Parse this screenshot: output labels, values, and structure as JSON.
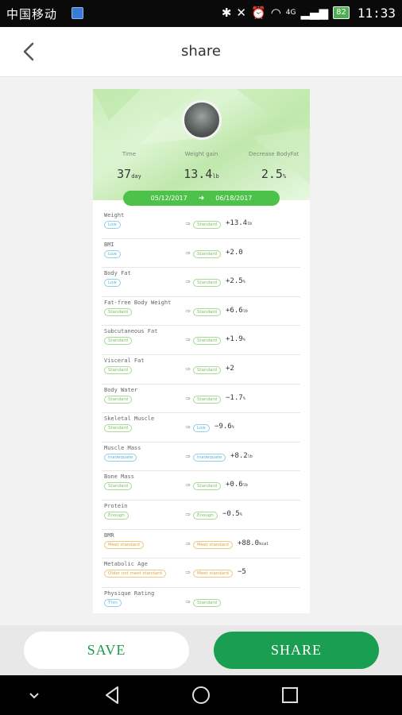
{
  "status_bar": {
    "carrier": "中国移动",
    "battery": "82",
    "network": "4G",
    "time": "11:33"
  },
  "header": {
    "title": "share",
    "back_icon": "chevron-left-icon"
  },
  "summary": {
    "labels": [
      "Time",
      "Weight gain",
      "Decrease BodyFat"
    ],
    "time_value": "37",
    "time_unit": "day",
    "weight_value": "13.4",
    "weight_unit": "lb",
    "fat_value": "2.5",
    "fat_unit": "%"
  },
  "range": {
    "start": "05/12/2017",
    "end": "06/18/2017"
  },
  "metrics": [
    {
      "name": "Weight",
      "from": "Low",
      "to": "Standard",
      "change": "+13.4",
      "unit": "lb"
    },
    {
      "name": "BMI",
      "from": "Low",
      "to": "Standard",
      "change": "+2.0",
      "unit": ""
    },
    {
      "name": "Body Fat",
      "from": "Low",
      "to": "Standard",
      "change": "+2.5",
      "unit": "%"
    },
    {
      "name": "Fat-free Body Weight",
      "from": "Standard",
      "to": "Standard",
      "change": "+6.6",
      "unit": "lb"
    },
    {
      "name": "Subcutaneous Fat",
      "from": "Standard",
      "to": "Standard",
      "change": "+1.9",
      "unit": "%"
    },
    {
      "name": "Visceral Fat",
      "from": "Standard",
      "to": "Standard",
      "change": "+2",
      "unit": ""
    },
    {
      "name": "Body Water",
      "from": "Standard",
      "to": "Standard",
      "change": "−1.7",
      "unit": "%"
    },
    {
      "name": "Skeletal Muscle",
      "from": "Standard",
      "to": "Low",
      "change": "−9.6",
      "unit": "%"
    },
    {
      "name": "Muscle Mass",
      "from": "Inadequate",
      "to": "Inadequate",
      "change": "+8.2",
      "unit": "lb"
    },
    {
      "name": "Bone Mass",
      "from": "Standard",
      "to": "Standard",
      "change": "+0.6",
      "unit": "lb"
    },
    {
      "name": "Protein",
      "from": "Enough",
      "to": "Enough",
      "change": "−0.5",
      "unit": "%"
    },
    {
      "name": "BMR",
      "from": "Meet standard",
      "to": "Meet standard",
      "change": "+88.0",
      "unit": "kcal"
    },
    {
      "name": "Metabolic Age",
      "from": "Older not meet standard",
      "to": "Meet standard",
      "change": "−5",
      "unit": ""
    },
    {
      "name": "Physique Rating",
      "from": "Thin",
      "to": "Standard",
      "change": "",
      "unit": ""
    }
  ],
  "buttons": {
    "save": "SAVE",
    "share": "SHARE"
  },
  "navbar": {
    "icons": [
      "chevron-down-icon",
      "back-triangle-icon",
      "home-circle-icon",
      "recents-square-icon"
    ]
  },
  "colors": {
    "accent_green": "#1a9e52",
    "range_green": "#4cc24a",
    "tag_blue": "#57b6dd",
    "tag_green": "#7cbf63",
    "tag_orange": "#e6a23c"
  }
}
